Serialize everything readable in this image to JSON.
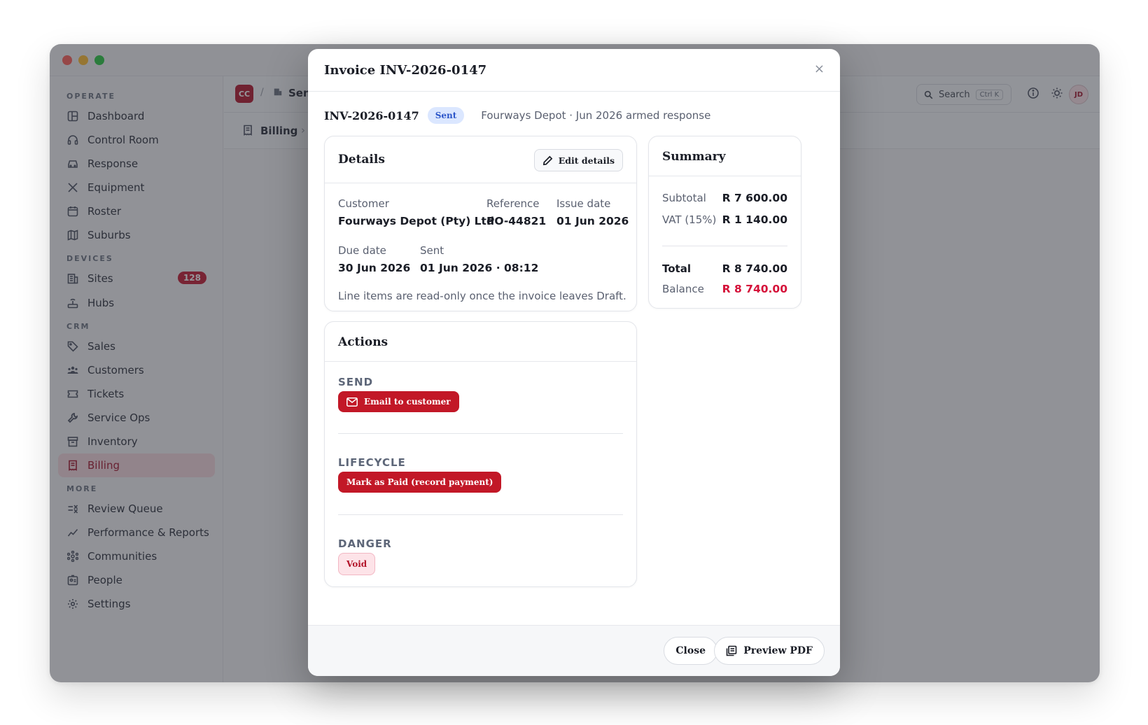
{
  "sidebar": {
    "sections": [
      {
        "title": "OPERATE",
        "items": [
          {
            "label": "Dashboard",
            "icon": "dashboard-icon"
          },
          {
            "label": "Control Room",
            "icon": "headset-icon"
          },
          {
            "label": "Response",
            "icon": "car-icon"
          },
          {
            "label": "Equipment",
            "icon": "tools-icon"
          },
          {
            "label": "Roster",
            "icon": "calendar-icon"
          },
          {
            "label": "Suburbs",
            "icon": "map-icon"
          }
        ]
      },
      {
        "title": "DEVICES",
        "items": [
          {
            "label": "Sites",
            "icon": "building-icon",
            "badge": "128"
          },
          {
            "label": "Hubs",
            "icon": "router-icon"
          }
        ]
      },
      {
        "title": "CRM",
        "items": [
          {
            "label": "Sales",
            "icon": "tag-icon"
          },
          {
            "label": "Customers",
            "icon": "users-icon"
          },
          {
            "label": "Tickets",
            "icon": "ticket-icon"
          },
          {
            "label": "Service Ops",
            "icon": "wrench-icon"
          },
          {
            "label": "Inventory",
            "icon": "archive-icon"
          },
          {
            "label": "Billing",
            "icon": "receipt-icon",
            "active": true
          }
        ]
      },
      {
        "title": "MORE",
        "items": [
          {
            "label": "Review Queue",
            "icon": "checklist-icon"
          },
          {
            "label": "Performance & Reports",
            "icon": "chart-line-icon"
          },
          {
            "label": "Communities",
            "icon": "network-icon"
          },
          {
            "label": "People",
            "icon": "id-badge-icon"
          },
          {
            "label": "Settings",
            "icon": "gear-icon"
          }
        ]
      }
    ]
  },
  "topbar": {
    "logo": "CC",
    "crumb_sep": "/",
    "crumb": "Sen",
    "search_label": "Search",
    "search_shortcut": "Ctrl K",
    "avatar": "JD"
  },
  "subbar": {
    "title": "Billing",
    "chevron": "›"
  },
  "modal": {
    "title": "Invoice INV-2026-0147",
    "close_symbol": "×",
    "invoice_id": "INV-2026-0147",
    "status": "Sent",
    "description": "Fourways Depot · Jun 2026 armed response",
    "details": {
      "title": "Details",
      "edit_label": "Edit details",
      "customer_label": "Customer",
      "customer_value": "Fourways Depot (Pty) Ltd",
      "reference_label": "Reference",
      "reference_value": "PO-44821",
      "issue_label": "Issue date",
      "issue_value": "01 Jun 2026",
      "due_label": "Due date",
      "due_value": "30 Jun 2026",
      "sent_label": "Sent",
      "sent_value": "01 Jun 2026 · 08:12",
      "note": "Line items are read-only once the invoice leaves Draft."
    },
    "summary": {
      "title": "Summary",
      "subtotal_label": "Subtotal",
      "subtotal_value": "R 7 600.00",
      "vat_label": "VAT (15%)",
      "vat_value": "R 1 140.00",
      "total_label": "Total",
      "total_value": "R 8 740.00",
      "balance_label": "Balance",
      "balance_value": "R 8 740.00",
      "balance_color": "#d5123a"
    },
    "actions": {
      "title": "Actions",
      "send_label": "SEND",
      "send_button": "Email to customer",
      "lifecycle_label": "LIFECYCLE",
      "lifecycle_button": "Mark as Paid (record payment)",
      "danger_label": "DANGER",
      "danger_button": "Void"
    },
    "footer": {
      "close_label": "Close",
      "preview_label": "Preview PDF"
    }
  },
  "colors": {
    "brand": "#c21827",
    "active_bg": "#f6d9df",
    "status_sent_bg": "#dbe7ff"
  }
}
